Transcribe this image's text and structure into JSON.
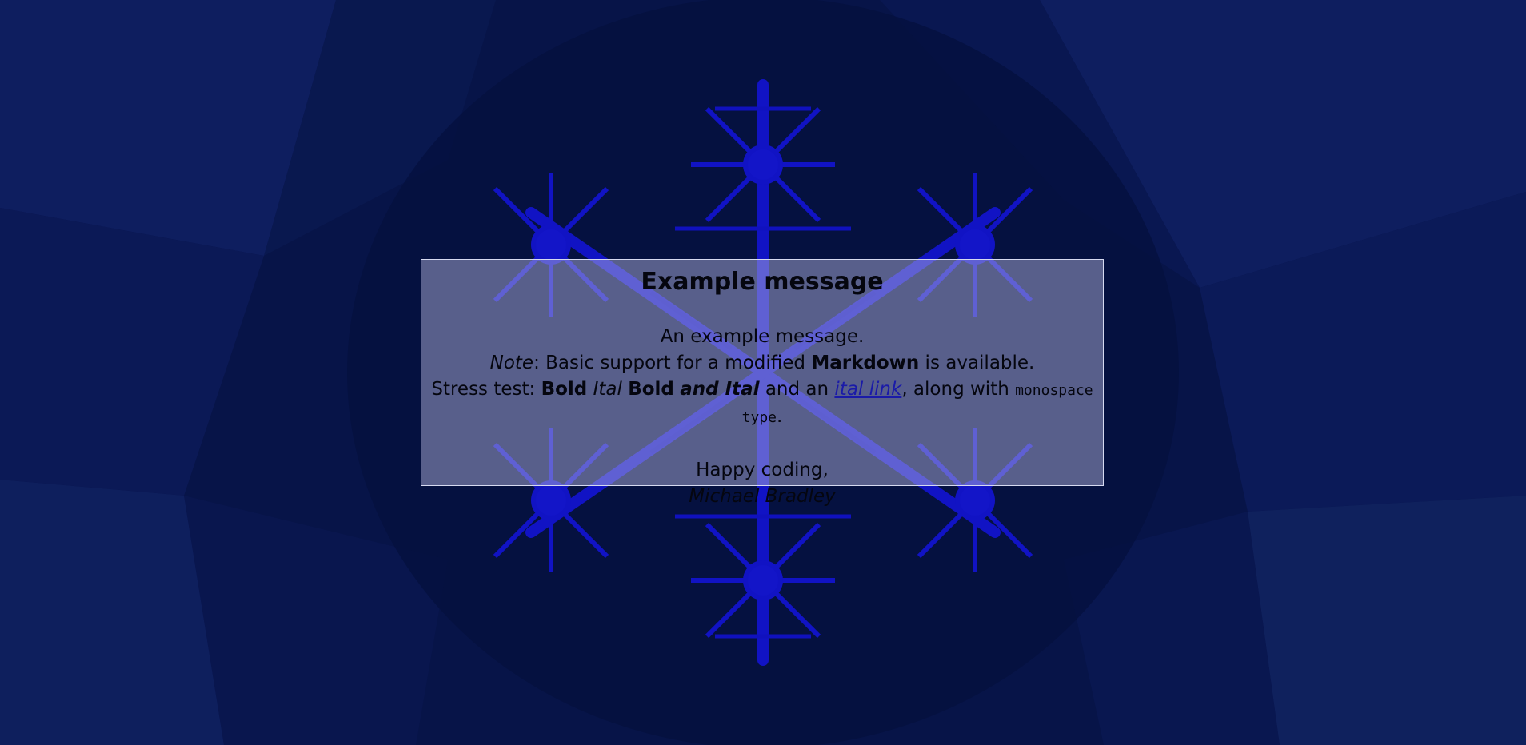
{
  "colors": {
    "background": "#071448",
    "snowflake": "#1212d8",
    "panel": "#8a8ab8",
    "link": "#1a1aa8"
  },
  "background": {
    "decoration": "blue-snowflake-fractal"
  },
  "message": {
    "title": "Example message",
    "line1": "An example message.",
    "line2": {
      "note_label": "Note",
      "text_before_bold": ": Basic support for a modified ",
      "bold_word": "Markdown",
      "text_after_bold": " is available."
    },
    "line3": {
      "prefix": "Stress test: ",
      "bold1": "Bold",
      "ital1": "Ital",
      "bold2": "Bold",
      "bold_ital": "and Ital",
      "mid": " and an ",
      "link_text": "ital link",
      "after_link": ", along with ",
      "mono": "monospace type",
      "end": "."
    },
    "closing": "Happy coding,",
    "signature": "Michael Bradley"
  }
}
